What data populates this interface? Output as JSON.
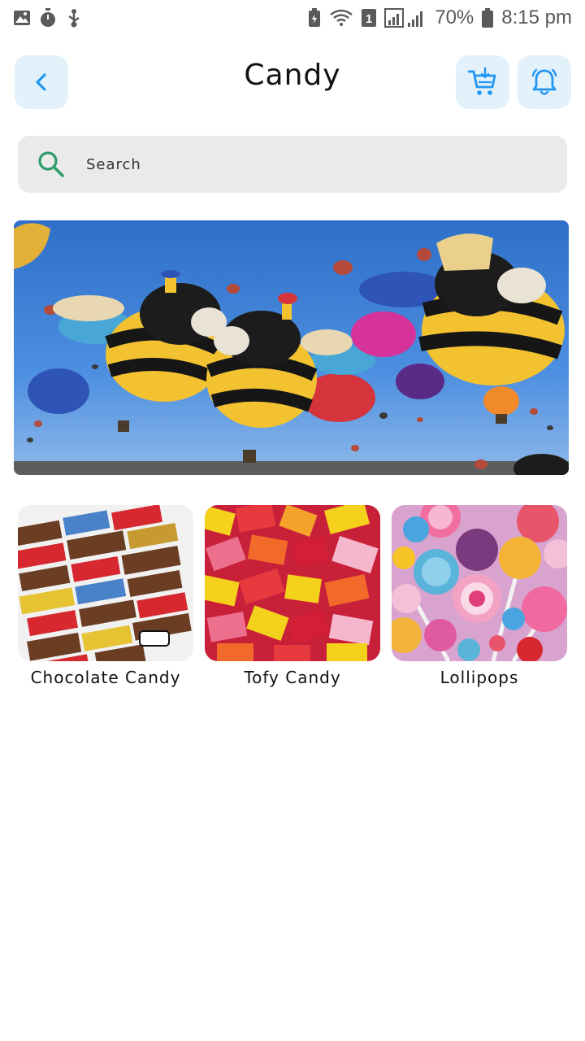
{
  "status_bar": {
    "battery_percent": "70%",
    "time": "8:15 pm",
    "sim_number": "1",
    "icons": [
      "gallery-icon",
      "stopwatch-icon",
      "usb-icon",
      "battery-saver-icon",
      "wifi-icon",
      "sim-icon",
      "signal-icon",
      "battery-icon"
    ]
  },
  "header": {
    "title": "Candy",
    "back_icon": "chevron-left-icon",
    "cart_icon": "add-to-cart-icon",
    "bell_icon": "bell-icon",
    "accent_color": "#2196F3",
    "button_bg": "#e3f1fb"
  },
  "search": {
    "placeholder": "Search",
    "value": "",
    "icon_color": "#2e9b6a"
  },
  "banner": {
    "subject": "hot air balloons shaped like bees"
  },
  "categories": [
    {
      "label": "Chocolate Candy",
      "image": "assorted chocolate candy bars"
    },
    {
      "label": "Tofy Candy",
      "image": "colorful wrapped toffee candies"
    },
    {
      "label": "Lollipops",
      "image": "colorful lollipops and candies"
    }
  ]
}
